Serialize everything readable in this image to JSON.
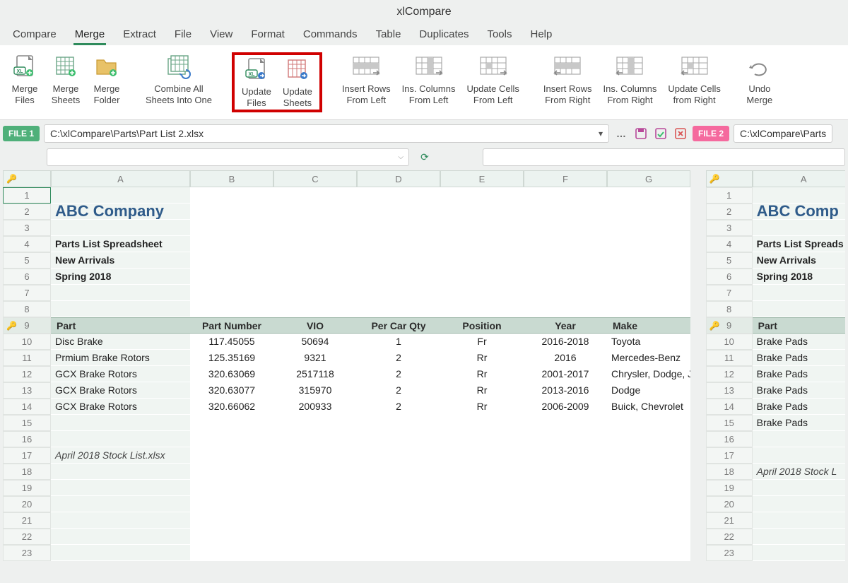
{
  "app": {
    "title": "xlCompare"
  },
  "menu": [
    "Compare",
    "Merge",
    "Extract",
    "File",
    "View",
    "Format",
    "Commands",
    "Table",
    "Duplicates",
    "Tools",
    "Help"
  ],
  "menu_active": "Merge",
  "ribbon": {
    "merge_files": "Merge\nFiles",
    "merge_sheets": "Merge\nSheets",
    "merge_folder": "Merge\nFolder",
    "combine_all": "Combine All\nSheets Into One",
    "update_files": "Update\nFiles",
    "update_sheets": "Update\nSheets",
    "insert_rows_left": "Insert Rows\nFrom Left",
    "ins_cols_left": "Ins. Columns\nFrom Left",
    "update_cells_left": "Update Cells\nFrom Left",
    "insert_rows_right": "Insert Rows\nFrom Right",
    "ins_cols_right": "Ins. Columns\nFrom Right",
    "update_cells_right": "Update Cells\nfrom Right",
    "undo_merge": "Undo\nMerge"
  },
  "file1": {
    "badge": "FILE 1",
    "path": "C:\\xlCompare\\Parts\\Part List 2.xlsx"
  },
  "file2": {
    "badge": "FILE 2",
    "path": "C:\\xlCompare\\Parts"
  },
  "columns_left": [
    "A",
    "B",
    "C",
    "D",
    "E",
    "F",
    "G"
  ],
  "columns_right": [
    "A"
  ],
  "header_row": {
    "part": "Part",
    "partnum": "Part Number",
    "vio": "VIO",
    "qty": "Per Car Qty",
    "pos": "Position",
    "year": "Year",
    "make": "Make"
  },
  "sheet_left": {
    "title": "ABC Company",
    "sub1": "Parts List Spreadsheet",
    "sub2": "New Arrivals",
    "sub3": "Spring 2018",
    "footer": "April 2018 Stock List.xlsx",
    "rows": [
      {
        "part": "Disc Brake",
        "num": "117.45055",
        "vio": "50694",
        "qty": "1",
        "pos": "Fr",
        "year": "2016-2018",
        "make": "Toyota"
      },
      {
        "part": "Prmium Brake Rotors",
        "num": "125.35169",
        "vio": "9321",
        "qty": "2",
        "pos": "Rr",
        "year": "2016",
        "make": "Mercedes-Benz"
      },
      {
        "part": "GCX Brake Rotors",
        "num": "320.63069",
        "vio": "2517118",
        "qty": "2",
        "pos": "Rr",
        "year": "2001-2017",
        "make": "Chrysler, Dodge, Jeep"
      },
      {
        "part": "GCX Brake Rotors",
        "num": "320.63077",
        "vio": "315970",
        "qty": "2",
        "pos": "Rr",
        "year": "2013-2016",
        "make": "Dodge"
      },
      {
        "part": "GCX Brake Rotors",
        "num": "320.66062",
        "vio": "200933",
        "qty": "2",
        "pos": "Rr",
        "year": "2006-2009",
        "make": "Buick, Chevrolet"
      }
    ]
  },
  "sheet_right": {
    "title": "ABC Comp",
    "sub1": "Parts List Spreads",
    "sub2": "New Arrivals",
    "sub3": "Spring 2018",
    "footer": "April 2018 Stock L",
    "rows": [
      {
        "part": "Brake Pads"
      },
      {
        "part": "Brake Pads"
      },
      {
        "part": "Brake Pads"
      },
      {
        "part": "Brake Pads"
      },
      {
        "part": "Brake Pads"
      },
      {
        "part": "Brake Pads"
      }
    ]
  },
  "row_nums_left": [
    1,
    2,
    3,
    4,
    5,
    6,
    7,
    8,
    9,
    10,
    11,
    12,
    13,
    14,
    15,
    16,
    17,
    18,
    19,
    20,
    21,
    22,
    23
  ],
  "row_nums_right": [
    1,
    2,
    3,
    4,
    5,
    6,
    7,
    8,
    9,
    10,
    11,
    12,
    13,
    14,
    15,
    16,
    17,
    18,
    19,
    20,
    21,
    22,
    23
  ]
}
